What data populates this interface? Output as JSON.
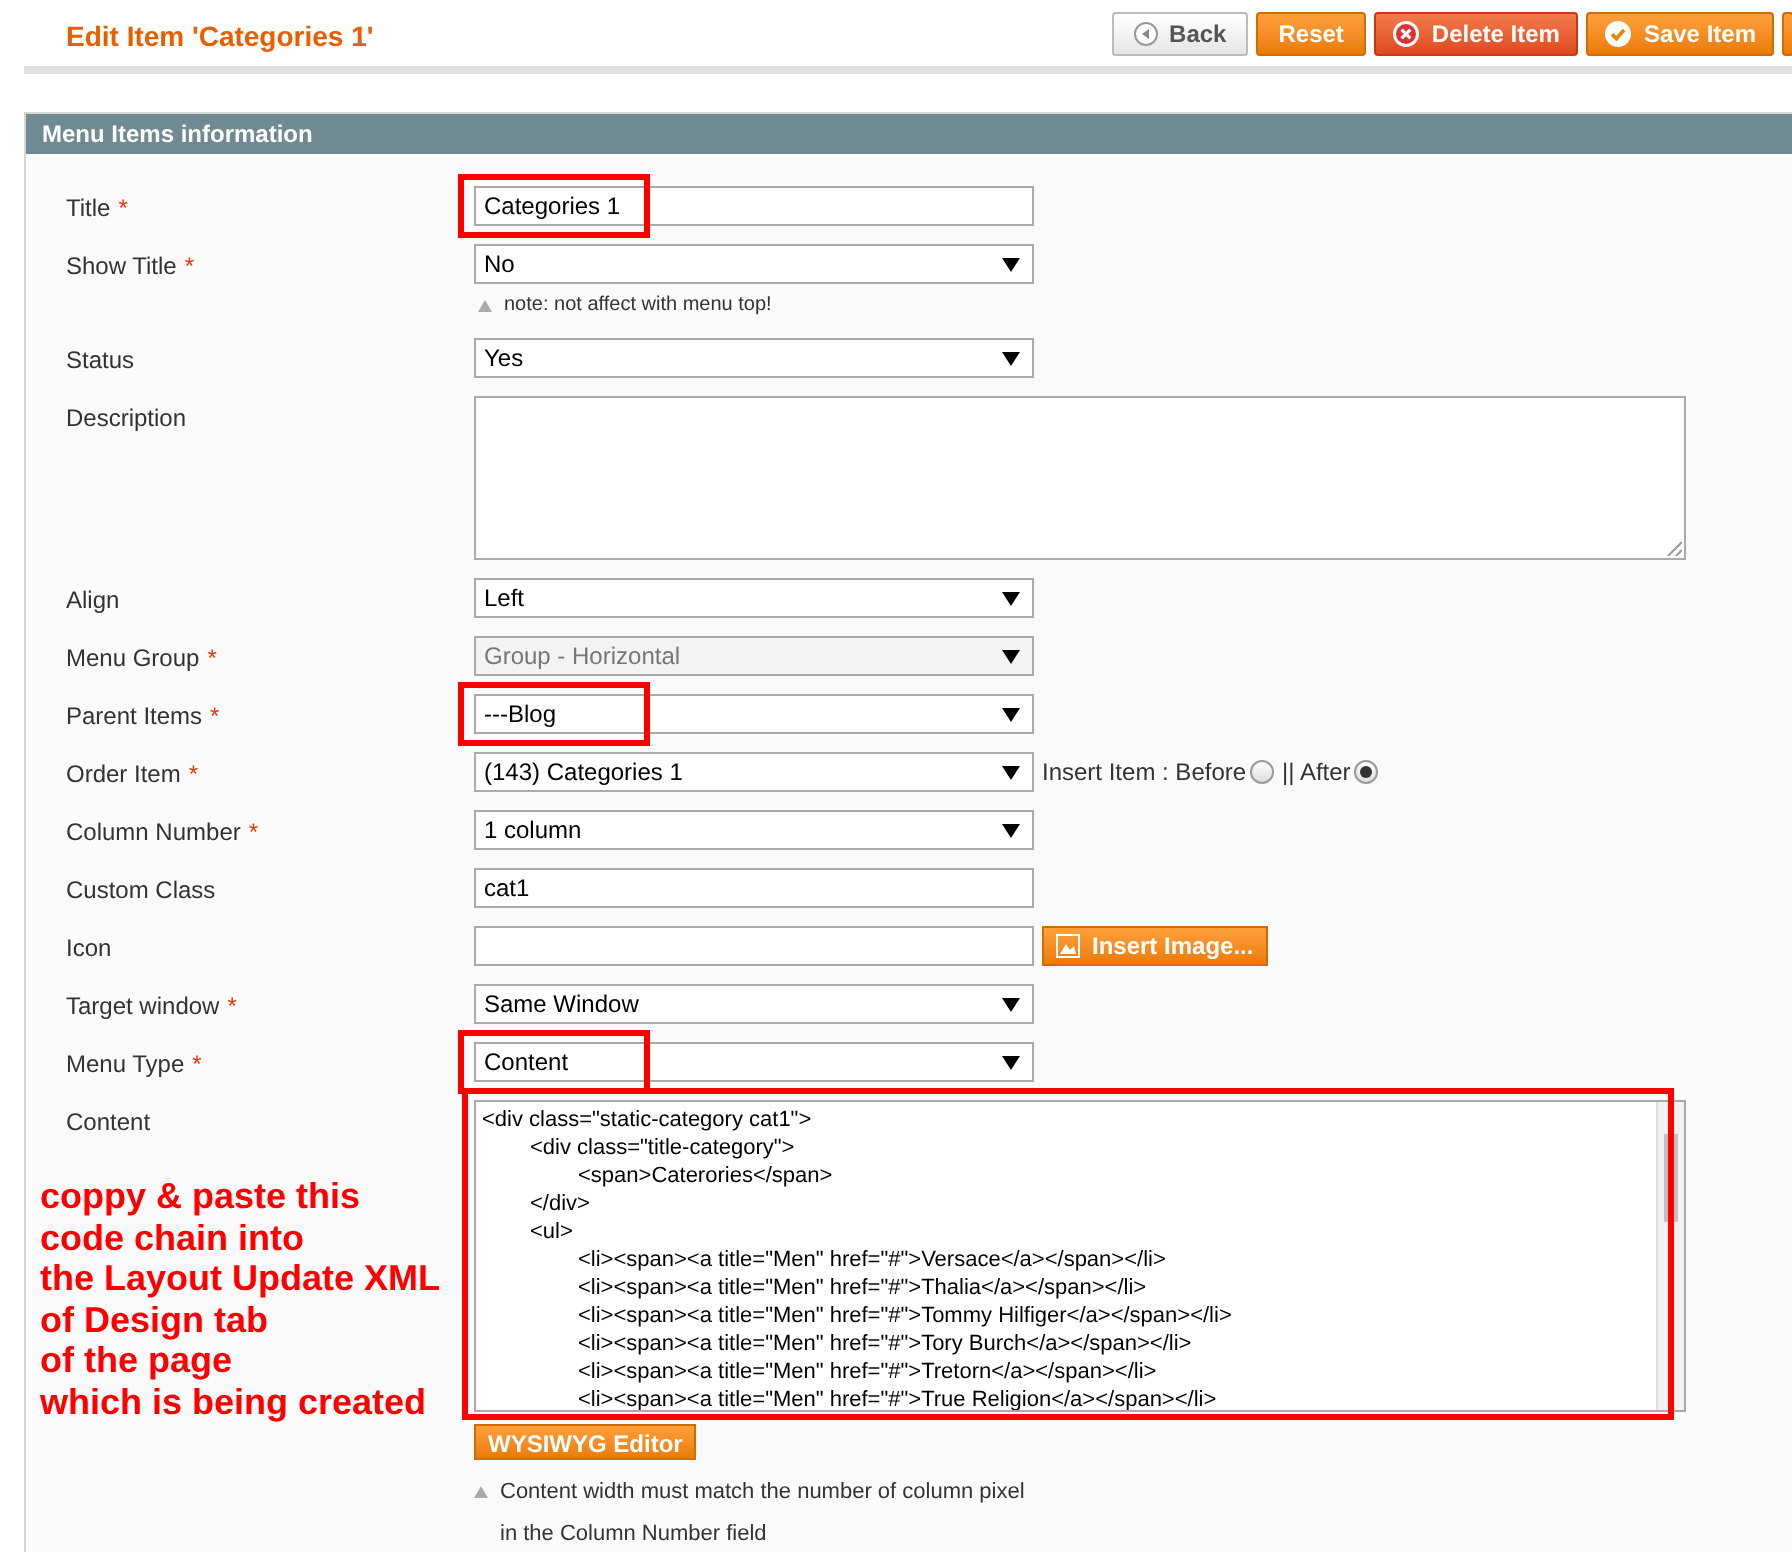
{
  "page_title": "Edit Item 'Categories 1'",
  "actions": [
    {
      "label": "Back",
      "kind": "back"
    },
    {
      "label": "Reset",
      "kind": "plain"
    },
    {
      "label": "Delete Item",
      "kind": "delete"
    },
    {
      "label": "Save Item",
      "kind": "save"
    },
    {
      "kind": "partial"
    }
  ],
  "section": {
    "title": "Menu Items information"
  },
  "fields": [
    {
      "label": "Title",
      "required": "*",
      "kind": "input",
      "value": "Categories 1",
      "highlighted": true,
      "disabled": false
    },
    {
      "label": "Show Title",
      "required": "*",
      "kind": "select",
      "value": "No",
      "highlighted": false,
      "disabled": false,
      "note": "note: not affect with menu top!"
    },
    {
      "label": "Status",
      "kind": "select",
      "value": "Yes",
      "highlighted": false,
      "disabled": false
    },
    {
      "label": "Description",
      "kind": "textarea",
      "highlighted": false,
      "disabled": false
    },
    {
      "label": "Align",
      "kind": "select",
      "value": "Left",
      "highlighted": false,
      "disabled": false
    },
    {
      "label": "Menu Group",
      "required": "*",
      "kind": "select",
      "value": "Group - Horizontal",
      "highlighted": false,
      "disabled": true
    },
    {
      "label": "Parent Items",
      "required": "*",
      "kind": "select",
      "value": "---Blog",
      "highlighted": true,
      "disabled": false
    },
    {
      "label": "Order Item",
      "required": "*",
      "kind": "select",
      "value": "(143) Categories 1",
      "highlighted": false,
      "disabled": false,
      "radios": [
        {
          "label": "Insert Item : Before",
          "selected": false
        },
        {
          "label": "|| After",
          "selected": true
        }
      ]
    },
    {
      "label": "Column Number",
      "required": "*",
      "kind": "select",
      "value": "1 column",
      "highlighted": false,
      "disabled": false
    },
    {
      "label": "Custom Class",
      "kind": "input",
      "value": "cat1",
      "highlighted": false,
      "disabled": false
    },
    {
      "label": "Icon",
      "kind": "input",
      "highlighted": false,
      "disabled": false,
      "button": "Insert Image..."
    },
    {
      "label": "Target window",
      "required": "*",
      "kind": "select",
      "value": "Same Window",
      "highlighted": false,
      "disabled": false
    },
    {
      "label": "Menu Type",
      "required": "*",
      "kind": "select",
      "value": "Content",
      "highlighted": true,
      "disabled": false
    },
    {
      "label": "Content",
      "kind": "code",
      "highlighted": true,
      "disabled": false,
      "lines": [
        "<div class=\"static-category cat1\">",
        "\t<div class=\"title-category\">",
        "\t\t<span>Caterories</span>",
        "\t</div>",
        "\t<ul>",
        "\t\t<li><span><a title=\"Men\" href=\"#\">Versace</a></span></li>",
        "\t\t<li><span><a title=\"Men\" href=\"#\">Thalia</a></span></li>",
        "\t\t<li><span><a title=\"Men\" href=\"#\">Tommy Hilfiger</a></span></li>",
        "\t\t<li><span><a title=\"Men\" href=\"#\">Tory Burch</a></span></li>",
        "\t\t<li><span><a title=\"Men\" href=\"#\">Tretorn</a></span></li>",
        "\t\t<li><span><a title=\"Men\" href=\"#\">True Religion</a></span></li>"
      ],
      "button": "WYSIWYG Editor",
      "notes": [
        "Content width must match the number of column pixel",
        "in the Column Number field"
      ]
    }
  ],
  "annotation": [
    "coppy & paste this",
    "code chain into",
    "the Layout Update XML",
    "of Design tab",
    "of the page",
    "which is being created"
  ]
}
